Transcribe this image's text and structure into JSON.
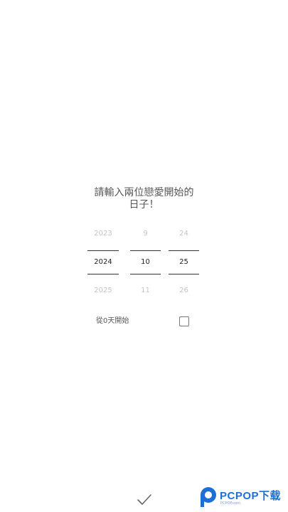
{
  "prompt": {
    "line1": "請輸入兩位戀愛開始的",
    "line2": "日子！"
  },
  "picker": {
    "year": {
      "prev": "2023",
      "selected": "2024",
      "next": "2025"
    },
    "month": {
      "prev": "9",
      "selected": "10",
      "next": "11"
    },
    "day": {
      "prev": "24",
      "selected": "25",
      "next": "26"
    }
  },
  "options": {
    "from_zero_label": "從0天開始",
    "from_zero_checked": false
  },
  "confirm_icon": "check-icon",
  "watermark": {
    "brand": "PCPOP下载",
    "sub": "PCPOP.com"
  },
  "colors": {
    "accent_watermark": "#1d6fd6",
    "text_selected": "#222222",
    "text_faded": "#c4c4c4"
  }
}
